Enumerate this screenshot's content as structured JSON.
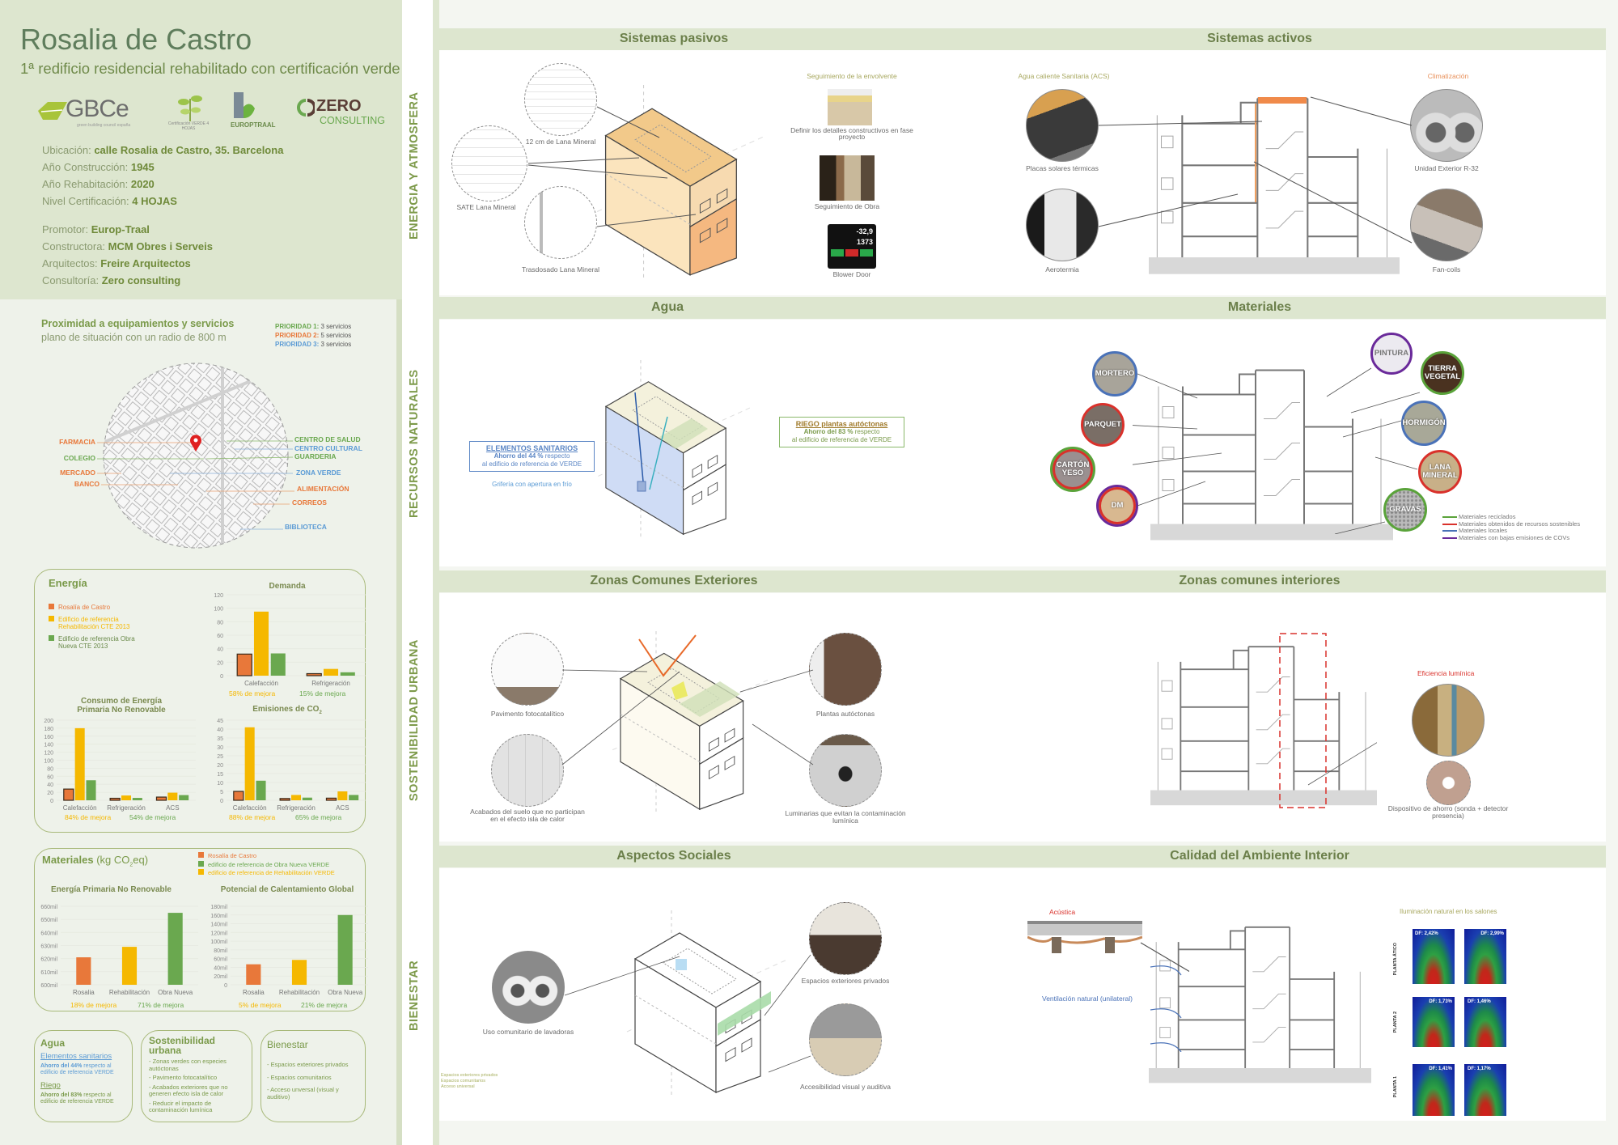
{
  "header": {
    "title": "Rosalia de Castro",
    "subtitle": "1ª redificio residencial rehabilitado con certificación verde",
    "logos": {
      "gbce": "GBCe",
      "gbce_tagline": "green building council españa",
      "cert_verde": "Certificación VERDE 4 HOJAS",
      "europtraal": "EUROPTRAAL",
      "zero_1": "ZERO",
      "zero_2": "CONSULTING"
    },
    "info": [
      {
        "label": "Ubicación: ",
        "value": "calle Rosalia de Castro, 35. Barcelona"
      },
      {
        "label": "Año Construcción: ",
        "value": "1945"
      },
      {
        "label": "Año Rehabitación: ",
        "value": "2020"
      },
      {
        "label": "Nivel Certificación: ",
        "value": "4 HOJAS"
      },
      {
        "label": "Promotor: ",
        "value": "Europ-Traal"
      },
      {
        "label": "Constructora: ",
        "value": "MCM Obres i Serveis"
      },
      {
        "label": "Arquitectos: ",
        "value": "Freire Arquitectos"
      },
      {
        "label": "Consultoría: ",
        "value": "Zero consulting"
      }
    ]
  },
  "proximity": {
    "title": "Proximidad a equipamientos y servicios",
    "subtitle": "plano de situación con un radio de 800 m",
    "priorities": [
      {
        "label": "PRIORIDAD 1:",
        "value": " 3 servicios",
        "color": "#6aa84f"
      },
      {
        "label": "PRIORIDAD 2:",
        "value": " 5 servicios",
        "color": "#e8783a"
      },
      {
        "label": "PRIORIDAD 3:",
        "value": " 3 servicios",
        "color": "#5b9bd5"
      }
    ],
    "services_left": [
      {
        "name": "FARMACIA",
        "color": "#e8783a"
      },
      {
        "name": "COLEGIO",
        "color": "#6aa84f"
      },
      {
        "name": "MERCADO",
        "color": "#e8783a"
      },
      {
        "name": "BANCO",
        "color": "#e8783a"
      }
    ],
    "services_right": [
      {
        "name": "CENTRO DE SALUD",
        "color": "#6aa84f"
      },
      {
        "name": "CENTRO CULTURAL",
        "color": "#5b9bd5"
      },
      {
        "name": "GUARDERIA",
        "color": "#6aa84f"
      },
      {
        "name": "ZONA VERDE",
        "color": "#5b9bd5"
      },
      {
        "name": "ALIMENTACIÓN",
        "color": "#e8783a"
      },
      {
        "name": "CORREOS",
        "color": "#e8783a"
      },
      {
        "name": "BIBLIOTECA",
        "color": "#5b9bd5"
      }
    ]
  },
  "energia": {
    "title": "Energía",
    "legend": [
      {
        "label": "Rosalía de Castro",
        "color": "#e8783a"
      },
      {
        "label": "Edificio de referencia Rehabilitación CTE 2013",
        "color": "#f5b800"
      },
      {
        "label": "Edificio de referencia Obra Nueva CTE 2013",
        "color": "#6aa84f"
      }
    ],
    "demanda_title": "Demanda",
    "consumo_title": "Consumo de Energía Primaria No Renovable",
    "co2_title": "Emisiones de CO",
    "co2_sub": "2",
    "improvements": {
      "demanda": [
        "58% de mejora",
        "15% de mejora"
      ],
      "consumo": [
        "84% de mejora",
        "54% de mejora"
      ],
      "co2": [
        "88% de mejora",
        "65% de mejora"
      ]
    }
  },
  "materiales": {
    "title": "Materiales",
    "unit_pre": "(kg CO",
    "unit_sub": "2",
    "unit_post": "eq)",
    "legend": [
      {
        "label": "Rosalía de Castro",
        "color": "#e8783a"
      },
      {
        "label": "edificio de referencia de Obra Nueva VERDE",
        "color": "#6aa84f"
      },
      {
        "label": "edificio de referencia de Rehabilitación VERDE",
        "color": "#f5b800"
      }
    ],
    "epnr_title": "Energía Primaria No Renovable",
    "pcg_title": "Potencial de Calentamiento Global",
    "improvements": {
      "epnr": [
        "18% de mejora",
        "71% de mejora"
      ],
      "pcg": [
        "5% de mejora",
        "21% de mejora"
      ]
    }
  },
  "chart_data": [
    {
      "id": "demanda",
      "type": "bar",
      "title": "Demanda",
      "categories": [
        "Calefacción",
        "Refrigeración"
      ],
      "ylim": [
        0,
        120
      ],
      "ticks": [
        0,
        20,
        40,
        60,
        80,
        100,
        120
      ],
      "series": [
        {
          "name": "Rosalía de Castro",
          "values": [
            32,
            3
          ],
          "color": "#e8783a"
        },
        {
          "name": "Edificio de referencia Rehabilitación CTE 2013",
          "values": [
            95,
            10
          ],
          "color": "#f5b800"
        },
        {
          "name": "Edificio de referencia Obra Nueva CTE 2013",
          "values": [
            33,
            5
          ],
          "color": "#6aa84f"
        }
      ]
    },
    {
      "id": "consumo",
      "type": "bar",
      "title": "Consumo de Energía Primaria No Renovable",
      "categories": [
        "Calefacción",
        "Refrigeración",
        "ACS"
      ],
      "ylim": [
        0,
        200
      ],
      "ticks": [
        0,
        20,
        40,
        60,
        80,
        100,
        120,
        140,
        160,
        180,
        200
      ],
      "series": [
        {
          "name": "Rosalía de Castro",
          "values": [
            28,
            5,
            8
          ],
          "color": "#e8783a"
        },
        {
          "name": "Edificio de referencia Rehabilitación CTE 2013",
          "values": [
            180,
            12,
            19
          ],
          "color": "#f5b800"
        },
        {
          "name": "Edificio de referencia Obra Nueva CTE 2013",
          "values": [
            50,
            6,
            13
          ],
          "color": "#6aa84f"
        }
      ]
    },
    {
      "id": "co2",
      "type": "bar",
      "title": "Emisiones de CO2",
      "categories": [
        "Calefacción",
        "Refrigeración",
        "ACS"
      ],
      "ylim": [
        0,
        45
      ],
      "ticks": [
        0,
        5,
        10,
        15,
        20,
        25,
        30,
        35,
        40,
        45
      ],
      "series": [
        {
          "name": "Rosalía de Castro",
          "values": [
            5,
            1,
            1.2
          ],
          "color": "#e8783a"
        },
        {
          "name": "Edificio de referencia Rehabilitación CTE 2013",
          "values": [
            41,
            3,
            5
          ],
          "color": "#f5b800"
        },
        {
          "name": "Edificio de referencia Obra Nueva CTE 2013",
          "values": [
            11,
            1.5,
            3
          ],
          "color": "#6aa84f"
        }
      ]
    },
    {
      "id": "epnr",
      "type": "bar",
      "title": "Energía Primaria No Renovable",
      "categories": [
        "Rosalia",
        "Rehabilitación",
        "Obra Nueva"
      ],
      "ylim": [
        600000,
        660000
      ],
      "ticks": [
        600000,
        610000,
        620000,
        630000,
        640000,
        650000,
        660000
      ],
      "tick_labels": [
        "600mil",
        "610mil",
        "620mil",
        "630mil",
        "640mil",
        "650mil",
        "660mil"
      ],
      "values": [
        621000,
        629000,
        655000
      ],
      "colors": [
        "#e8783a",
        "#f5b800",
        "#6aa84f"
      ]
    },
    {
      "id": "pcg",
      "type": "bar",
      "title": "Potencial de Calentamiento Global",
      "categories": [
        "Rosalia",
        "Rehabilitación",
        "Obra Nueva"
      ],
      "ylim": [
        0,
        180000
      ],
      "ticks": [
        0,
        20000,
        40000,
        60000,
        80000,
        100000,
        120000,
        140000,
        160000,
        180000
      ],
      "tick_labels": [
        "0",
        "20mil",
        "40mil",
        "60mil",
        "80mil",
        "100mil",
        "120mil",
        "140mil",
        "160mil",
        "180mil"
      ],
      "values": [
        47000,
        57000,
        160000
      ],
      "colors": [
        "#e8783a",
        "#f5b800",
        "#6aa84f"
      ]
    }
  ],
  "summary": {
    "agua": {
      "title": "Agua",
      "item1": "Elementos sanitarios",
      "item1_bold": "Ahorro del 44%",
      "item1_text": " respecto al edificio de referencia VERDE",
      "item2": "Riego",
      "item2_bold": "Ahorro del 83%",
      "item2_text": " respecto al edificio de referencia VERDE"
    },
    "sostenibilidad": {
      "title": "Sostenibilidad urbana",
      "items": [
        "- Zonas verdes con especies autóctonas",
        "- Pavimento fotocatalítico",
        "- Acabados exteriores que no generen efecto isla de calor",
        "- Reducir el impacto de contaminación lumínica"
      ]
    },
    "bienestar": {
      "title": "Bienestar",
      "items": [
        "- Espacios exteriores privados",
        "- Espacios comunitarios",
        "- Acceso unversal (visual y auditivo)"
      ]
    }
  },
  "categories": [
    "ENERGIA Y ATMOSFERA",
    "RECURSOS NATURALES",
    "SOSTENIBILIDAD URBANA",
    "BIENESTAR"
  ],
  "sections": {
    "pasivos": {
      "title": "Sistemas pasivos",
      "c1": "12 cm de Lana Mineral",
      "c2": "SATE Lana Mineral",
      "c3": "Trasdosado Lana Mineral",
      "seg_title": "Seguimiento de la envolvente",
      "seg1": "Definir los detalles constructivos en fase proyecto",
      "seg2": "Seguimiento de Obra",
      "seg3": "Blower Door",
      "bd_v1": "-32,9",
      "bd_v2": "1373"
    },
    "activos": {
      "title": "Sistemas activos",
      "acs": "Agua caliente Sanitaria (ACS)",
      "clima": "Climatización",
      "c1": "Placas solares térmicas",
      "c2": "Aerotermia",
      "c3": "Unidad Exterior R-32",
      "c4": "Fan-coils"
    },
    "agua": {
      "title": "Agua",
      "san_title": "ELEMENTOS SANITARIOS",
      "san_bold": "Ahorro del 44 %",
      "san_1": " respecto",
      "san_2": "al edificio de referencia de VERDE",
      "griferia": "Grifería con apertura en frío",
      "riego_title": "RIEGO plantas autóctonas",
      "riego_bold": "Ahorro del 83 %",
      "riego_1": " respecto",
      "riego_2": "al edificio de referencia de VERDE"
    },
    "materiales": {
      "title": "Materiales",
      "items": [
        "MORTERO",
        "PARQUET",
        "CARTÓN YESO",
        "DM",
        "PINTURA",
        "TIERRA VEGETAL",
        "HORMIGÓN",
        "LANA MINERAL",
        "GRAVAS"
      ],
      "legend": [
        {
          "label": "Materiales reciclados",
          "color": "#5aa33a"
        },
        {
          "label": "Materiales obtenidos de recursos sostenibles",
          "color": "#d9312b"
        },
        {
          "label": "Materiales locales",
          "color": "#4a72b8"
        },
        {
          "label": "Materiales con bajas emisiones de COVs",
          "color": "#6a2a9a"
        }
      ]
    },
    "ext": {
      "title": "Zonas Comunes Exteriores",
      "c1": "Pavimento fotocatalítico",
      "c2": "Acabados del suelo que no participan en el efecto isla de calor",
      "c3": "Plantas autóctonas",
      "c4": "Luminarias que evitan la contaminación lumínica"
    },
    "int": {
      "title": "Zonas comunes interiores",
      "ef": "Eficiencia lumínica",
      "dev": "Dispositivo de ahorro (sonda + detector presencia)"
    },
    "sociales": {
      "title": "Aspectos Sociales",
      "c1": "Uso comunitario de lavadoras",
      "c2": "Espacios exteriores privados",
      "c3": "Accesibilidad visual y auditiva",
      "legend": [
        "Espacios exteriores privados",
        "Espacios comunitarios",
        "Acceso universal"
      ]
    },
    "calidad": {
      "title": "Calidad del Ambiente Interior",
      "acustica": "Acústica",
      "vent": "Ventilación natural (unilateral)",
      "ilum": "Iluminación natural en los salones",
      "rows": [
        "PLANTA ÁTICO",
        "PLANTA 2",
        "PLANTA 1"
      ],
      "df": [
        "DF: 2,42%",
        "DF: 2,99%",
        "DF: 1,73%",
        "DF: 1,46%",
        "DF: 1,41%",
        "DF: 1,17%"
      ]
    }
  }
}
